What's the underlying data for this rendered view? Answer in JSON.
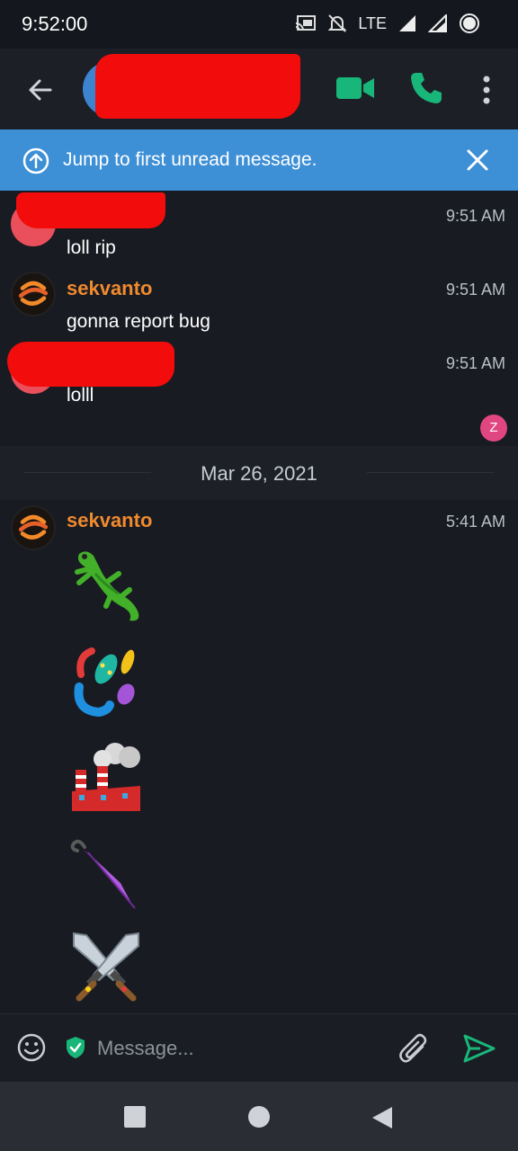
{
  "status_bar": {
    "time": "9:52:00",
    "network": "LTE",
    "battery": "88"
  },
  "header": {
    "icons": [
      "back-arrow-icon",
      "video-call-icon",
      "phone-icon",
      "more-vert-icon"
    ],
    "colors": {
      "accent_green": "#19b67a",
      "avatar_blue": "#3c83d0"
    }
  },
  "banner": {
    "text": "Jump to first unread message.",
    "color": "#3d8fd6"
  },
  "messages": [
    {
      "sender": "",
      "time": "9:51 AM",
      "text": "loll rip"
    },
    {
      "sender": "sekvanto",
      "time": "9:51 AM",
      "text": "gonna report bug"
    },
    {
      "sender": "",
      "time": "9:51 AM",
      "text": "lolll"
    }
  ],
  "reaction_badge": "Z",
  "date_divider": "Mar 26, 2021",
  "emoji_message": {
    "sender": "sekvanto",
    "time": "5:41 AM",
    "emojis": [
      "lizard",
      "microbe",
      "factory",
      "closed-umbrella",
      "crossed-swords"
    ]
  },
  "composer": {
    "placeholder": "Message..."
  },
  "colors": {
    "background": "#181b22",
    "sender_orange": "#f08a2e",
    "send_green": "#19b67a"
  }
}
